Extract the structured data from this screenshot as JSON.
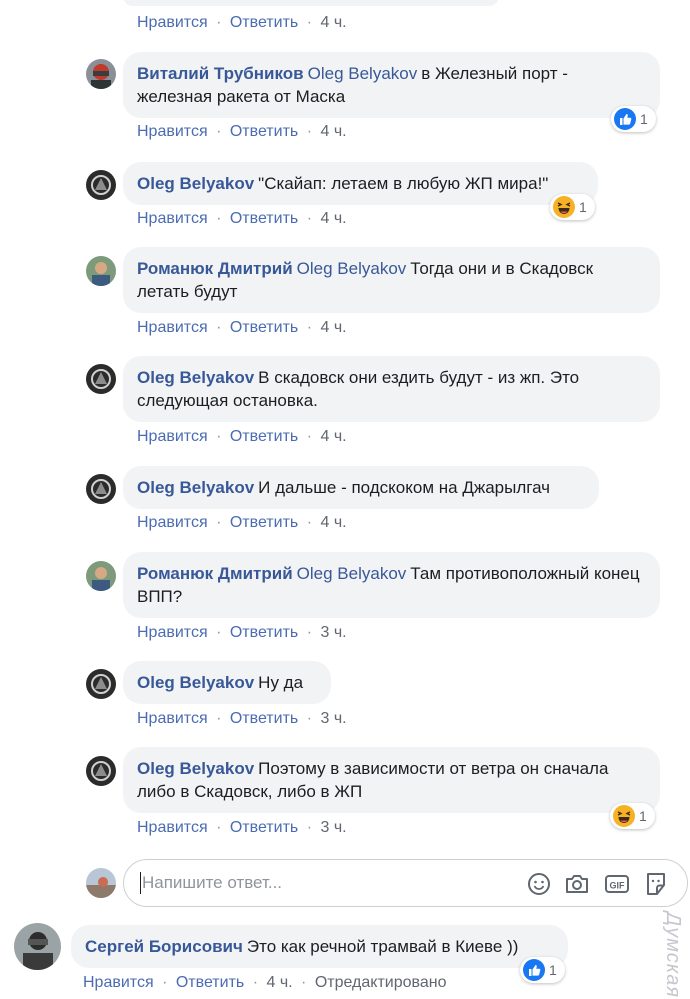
{
  "actions": {
    "like": "Нравится",
    "reply": "Ответить",
    "dot": "·"
  },
  "top_partial": {
    "time": "4 ч."
  },
  "comments": [
    {
      "author": "Виталий Трубников",
      "mention": "Oleg Belyakov",
      "text": "в Железный порт - железная ракета от Маска",
      "time": "4 ч.",
      "reaction": {
        "type": "like",
        "count": "1"
      }
    },
    {
      "author": "Oleg Belyakov",
      "text": "\"Скайап: летаем в любую ЖП мира!\"",
      "time": "4 ч.",
      "reaction": {
        "type": "haha",
        "count": "1"
      }
    },
    {
      "author": "Романюк Дмитрий",
      "mention": "Oleg Belyakov",
      "text": "Тогда они и в Скадовск летать будут",
      "time": "4 ч."
    },
    {
      "author": "Oleg Belyakov",
      "text": "В скадовск они ездить будут - из жп. Это следующая остановка.",
      "time": "4 ч."
    },
    {
      "author": "Oleg Belyakov",
      "text": "И дальше - подскоком на Джарылгач",
      "time": "4 ч."
    },
    {
      "author": "Романюк Дмитрий",
      "mention": "Oleg Belyakov",
      "text": "Там противоположный конец ВПП?",
      "time": "3 ч."
    },
    {
      "author": "Oleg Belyakov",
      "text": "Ну да",
      "time": "3 ч."
    },
    {
      "author": "Oleg Belyakov",
      "text": "Поэтому в зависимости от ветра он сначала либо в Скадовск, либо в ЖП",
      "time": "3 ч.",
      "reaction": {
        "type": "haha",
        "count": "1"
      }
    }
  ],
  "reply_box": {
    "placeholder": "Напишите ответ...",
    "icons": [
      "emoji-icon",
      "camera-icon",
      "gif-icon",
      "sticker-icon"
    ]
  },
  "main_comment": {
    "author": "Сергей Борисович",
    "text": "Это как речной трамвай в Киеве ))",
    "time": "4 ч.",
    "edited": "Отредактировано",
    "reaction": {
      "type": "like",
      "count": "1"
    }
  },
  "watermark": "Думская",
  "colors": {
    "link": "#385898",
    "action": "#4b6cb2",
    "bubble": "#f2f3f5",
    "like": "#1877f2",
    "haha": "#f7b125"
  }
}
